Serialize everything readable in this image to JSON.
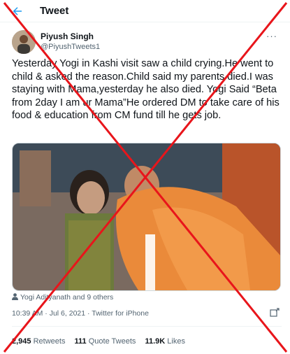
{
  "header": {
    "title": "Tweet"
  },
  "author": {
    "name": "Piyush Singh",
    "handle": "@PiyushTweets1"
  },
  "tweet": {
    "text": "Yesterday Yogi in Kashi visit saw a child crying.He went to child & asked the reason.Child said my parents died.I was staying with Mama,yesterday he also died. Yogi Said “Beta from 2day I am ur Mama”He ordered DM to take care of his food & education from CM fund till he gets job."
  },
  "tagged": {
    "text": "Yogi Adityanath and 9 others"
  },
  "meta": {
    "time": "10:39 AM",
    "date": "Jul 6, 2021",
    "source": "Twitter for iPhone"
  },
  "stats": {
    "retweets_count": "2,945",
    "retweets_label": "Retweets",
    "quotes_count": "111",
    "quotes_label": "Quote Tweets",
    "likes_count": "11.9K",
    "likes_label": "Likes"
  },
  "colors": {
    "accent": "#1d9bf0",
    "cross": "#e8151b",
    "muted": "#536471"
  },
  "icons": [
    "back-arrow-icon",
    "more-icon",
    "person-icon",
    "retweet-icon"
  ]
}
